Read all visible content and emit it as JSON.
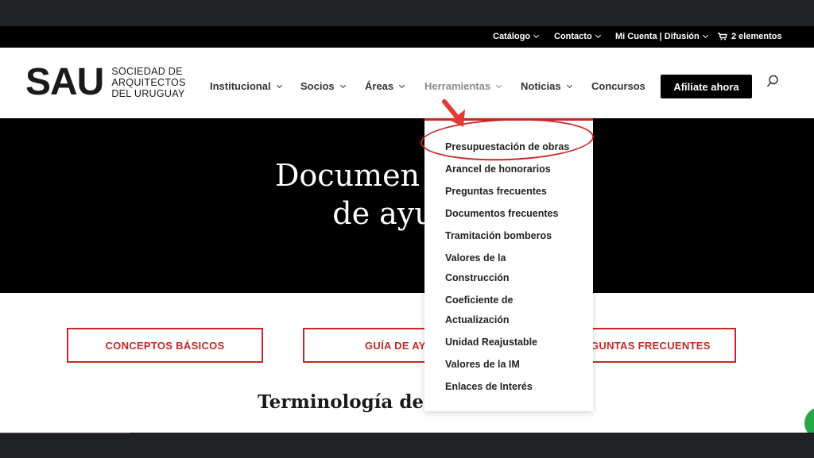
{
  "topbar": {
    "catalogo": "Catálogo",
    "contacto": "Contacto",
    "cuenta": "Mi Cuenta | Difusión",
    "cart": "2 elementos"
  },
  "logo": {
    "mark": "SAU",
    "line1": "SOCIEDAD DE",
    "line2": "ARQUITECTOS",
    "line3": "DEL URUGUAY"
  },
  "nav": {
    "institucional": "Institucional",
    "socios": "Socios",
    "areas": "Áreas",
    "herramientas": "Herramientas",
    "noticias": "Noticias",
    "concursos": "Concursos",
    "cta": "Afiliate ahora"
  },
  "hero": {
    "line1": "Documen",
    "line2": "de ayu"
  },
  "buttons": {
    "conceptos": "CONCEPTOS BÁSICOS",
    "guia": "GUÍA DE AYU",
    "preguntas": "EGUNTAS FRECUENTES"
  },
  "section_title": "Terminología de l",
  "dropdown": {
    "items": [
      "Presupuestación de obras",
      "Arancel de honorarios",
      "Preguntas frecuentes",
      "Documentos frecuentes",
      "Tramitación bomberos",
      "Valores de la",
      "Construcción",
      "Coeficiente de",
      "Actualización",
      "Unidad Reajustable",
      "Valores de la IM",
      "Enlaces de Interés"
    ]
  },
  "colors": {
    "accent": "#c62828",
    "black": "#000000"
  }
}
